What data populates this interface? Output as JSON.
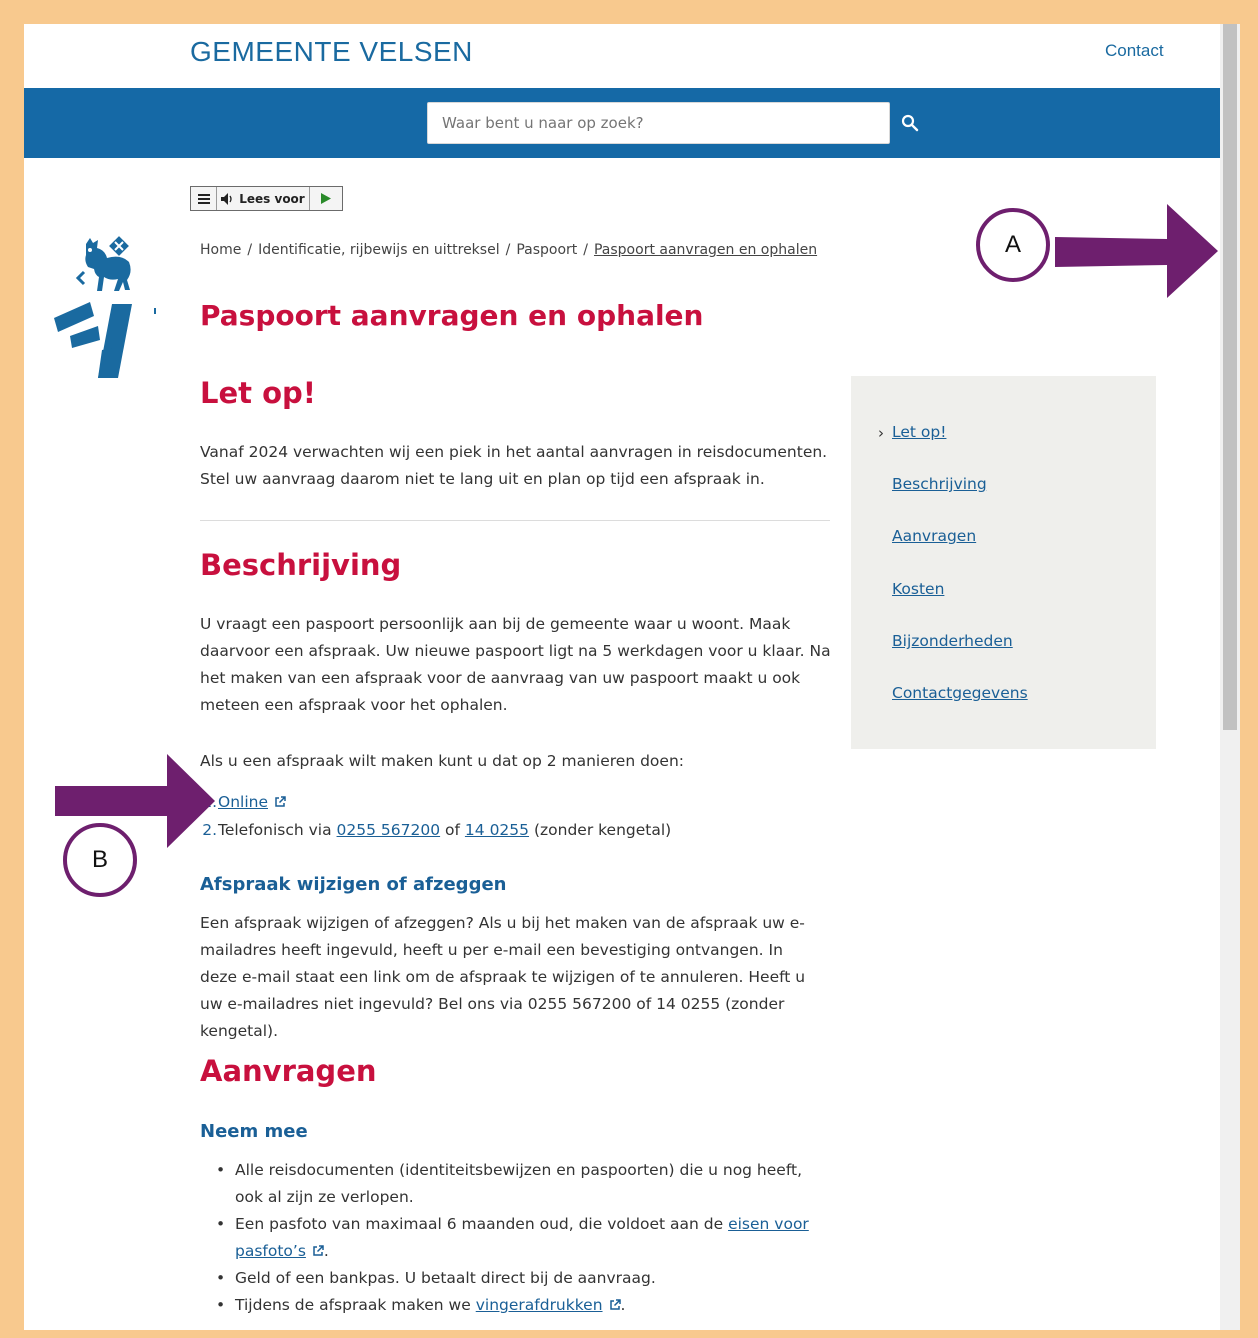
{
  "header": {
    "brand": "GEMEENTE VELSEN",
    "contact_label": "Contact"
  },
  "search": {
    "placeholder": "Waar bent u naar op zoek?"
  },
  "readspeaker": {
    "label": "Lees voor"
  },
  "breadcrumb": {
    "items": [
      "Home",
      "Identificatie, rijbewijs en uittreksel",
      "Paspoort",
      "Paspoort aanvragen en ophalen"
    ]
  },
  "page_title": "Paspoort aanvragen en ophalen",
  "sections": {
    "letop": {
      "heading": "Let op!",
      "text": "Vanaf 2024 verwachten wij een piek in het aantal aanvragen in reisdocumenten. Stel uw aanvraag daarom niet te lang uit en plan op tijd een afspraak in."
    },
    "beschrijving": {
      "heading": "Beschrijving",
      "text": "U vraagt een paspoort persoonlijk aan bij de gemeente waar u woont. Maak daarvoor een afspraak. Uw nieuwe paspoort ligt na 5 werkdagen voor u klaar. Na het maken van een afspraak voor de aanvraag van uw paspoort maakt u ook meteen een afspraak voor het ophalen.",
      "intro": "Als u een afspraak wilt maken kunt u dat op 2 manieren doen:",
      "options": {
        "one_num": "1.",
        "one_link": "Online",
        "two_num": "2.",
        "two_prefix": "Telefonisch via",
        "phone1": "0255 567200",
        "two_mid": "of",
        "phone2": "14 0255",
        "two_suffix": "(zonder kengetal)"
      }
    },
    "afspraak": {
      "heading": "Afspraak wijzigen of afzeggen",
      "text": "Een afspraak wijzigen of afzeggen? Als u bij het maken van de afspraak uw e-mailadres heeft ingevuld, heeft u per e-mail een bevestiging ontvangen. In deze e-mail staat een link om de afspraak te wijzigen of te annuleren. Heeft u uw e-mailadres niet ingevuld? Bel ons via 0255 567200 of 14 0255 (zonder kengetal)."
    },
    "aanvragen": {
      "heading": "Aanvragen",
      "subheading": "Neem mee",
      "item1": "Alle reisdocumenten (identiteitsbewijzen en paspoorten) die u nog heeft, ook al zijn ze verlopen.",
      "item2_prefix": "Een pasfoto van maximaal 6 maanden oud, die voldoet aan de",
      "item2_link": "eisen voor pasfoto’s",
      "item2_suffix": ".",
      "item3": "Geld of een bankpas. U betaalt direct bij de aanvraag.",
      "item4_prefix": "Tijdens de afspraak maken we",
      "item4_link": "vingerafdrukken",
      "item4_suffix": "."
    }
  },
  "toc": {
    "items": [
      "Let op!",
      "Beschrijving",
      "Aanvragen",
      "Kosten",
      "Bijzonderheden",
      "Contactgegevens"
    ]
  },
  "annotations": {
    "marker_a": "A",
    "marker_b": "B",
    "arrow_color": "#6e1f6e"
  },
  "colors": {
    "brand_blue": "#1569a6",
    "heading_red": "#c8103e",
    "link_blue": "#1a5f96",
    "frame_border": "#f8c98e"
  }
}
